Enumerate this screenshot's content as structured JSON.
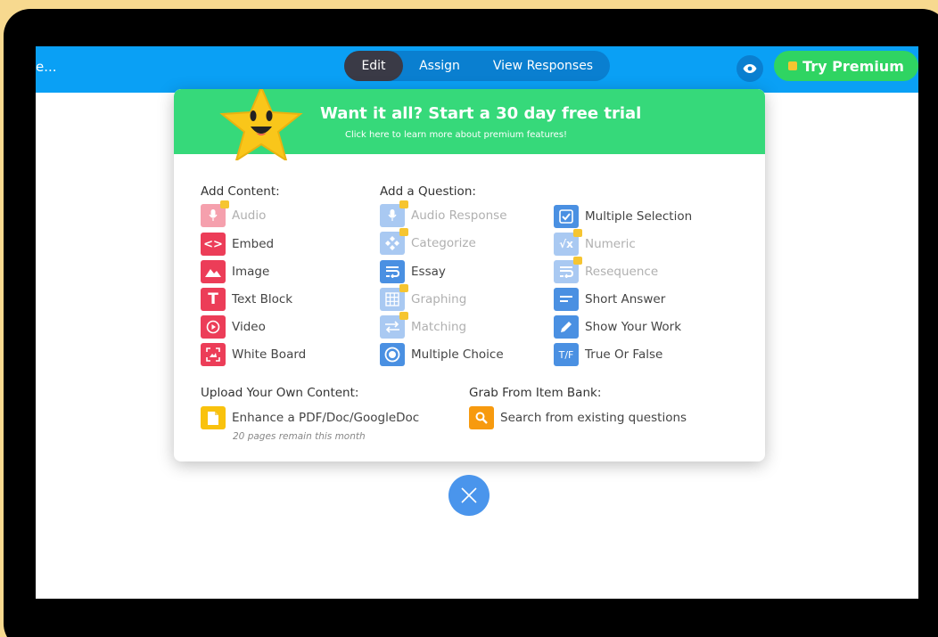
{
  "header": {
    "doc_title": "e...",
    "tabs": [
      {
        "label": "Edit"
      },
      {
        "label": "Assign"
      },
      {
        "label": "View Responses"
      }
    ],
    "premium_label": "Try Premium"
  },
  "banner": {
    "title": "Want it all? Start a 30 day free trial",
    "subtitle": "Click here to learn more about premium features!"
  },
  "add_content": {
    "heading": "Add Content:",
    "items": [
      {
        "label": "Audio",
        "icon": "microphone-icon",
        "locked": true
      },
      {
        "label": "Embed",
        "icon": "code-icon",
        "locked": false
      },
      {
        "label": "Image",
        "icon": "image-icon",
        "locked": false
      },
      {
        "label": "Text Block",
        "icon": "text-icon",
        "locked": false
      },
      {
        "label": "Video",
        "icon": "play-icon",
        "locked": false
      },
      {
        "label": "White Board",
        "icon": "whiteboard-icon",
        "locked": false
      }
    ]
  },
  "add_question": {
    "heading": "Add a Question:",
    "items_left": [
      {
        "label": "Audio Response",
        "icon": "microphone-icon",
        "locked": true
      },
      {
        "label": "Categorize",
        "icon": "categorize-icon",
        "locked": true
      },
      {
        "label": "Essay",
        "icon": "essay-icon",
        "locked": false
      },
      {
        "label": "Graphing",
        "icon": "grid-icon",
        "locked": true
      },
      {
        "label": "Matching",
        "icon": "matching-icon",
        "locked": true
      },
      {
        "label": "Multiple Choice",
        "icon": "radio-icon",
        "locked": false
      }
    ],
    "items_right": [
      {
        "label": "Multiple Selection",
        "icon": "checkbox-icon",
        "locked": false
      },
      {
        "label": "Numeric",
        "icon": "sqrt-icon",
        "locked": true
      },
      {
        "label": "Resequence",
        "icon": "resequence-icon",
        "locked": true
      },
      {
        "label": "Short Answer",
        "icon": "short-answer-icon",
        "locked": false
      },
      {
        "label": "Show Your Work",
        "icon": "pencil-icon",
        "locked": false
      },
      {
        "label": "True Or False",
        "icon": "true-false-icon",
        "badge": "T/F",
        "locked": false
      }
    ]
  },
  "upload": {
    "heading": "Upload Your Own Content:",
    "item_label": "Enhance a PDF/Doc/GoogleDoc",
    "note": "20 pages remain this month"
  },
  "item_bank": {
    "heading": "Grab From Item Bank:",
    "item_label": "Search from existing questions"
  },
  "colors": {
    "topbar": "#0aa0f5",
    "banner": "#36d97a",
    "premium": "#2fd462",
    "content_red": "#ec3d58",
    "question_blue": "#4a90e2"
  }
}
